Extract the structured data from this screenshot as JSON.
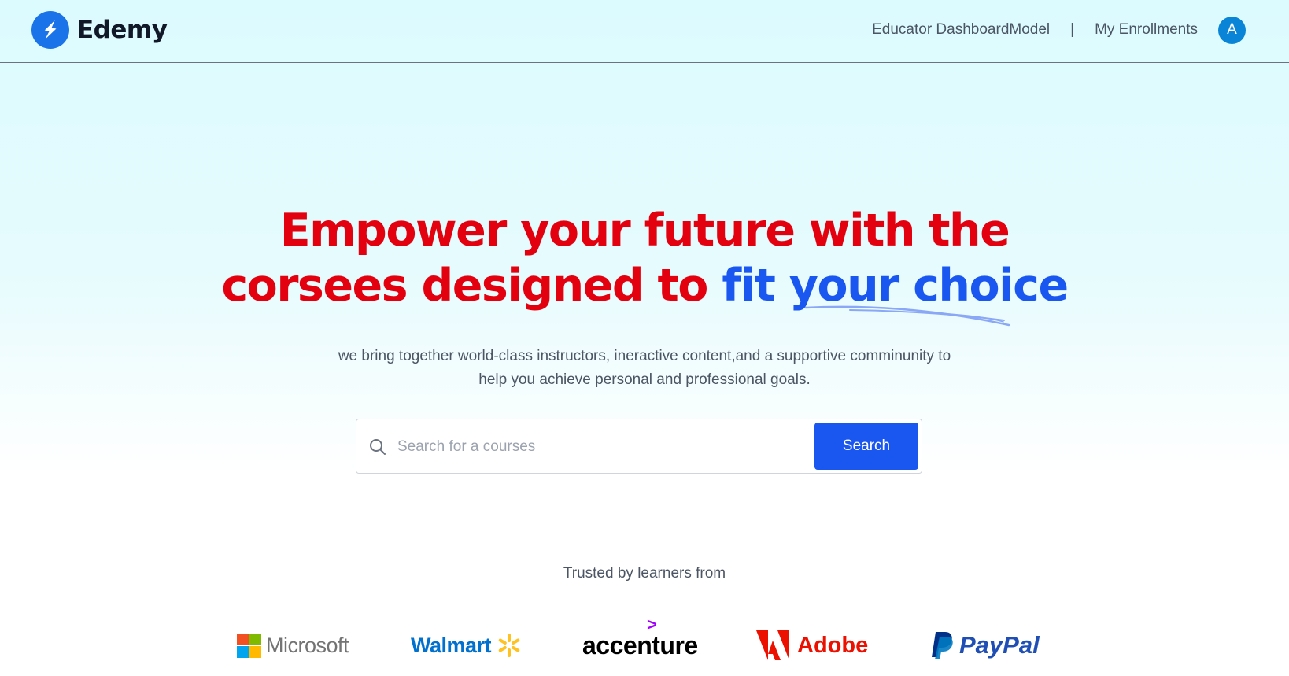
{
  "header": {
    "logo_text": "Edemy",
    "nav": {
      "educator_link": "Educator DashboardModel",
      "separator": "|",
      "enrollments_link": "My Enrollments",
      "avatar_initial": "A"
    }
  },
  "hero": {
    "headline_line1": "Empower your future with the",
    "headline_line2_red": "corsees designed to",
    "headline_line2_blue": "fit your choice",
    "subtitle_line1": "we bring together world-class instructors, ineractive content,and a supportive comminunity to",
    "subtitle_line2": "help you achieve personal and professional goals."
  },
  "search": {
    "placeholder": "Search for a courses",
    "value": "",
    "button_label": "Search"
  },
  "trusted": {
    "label": "Trusted by learners from",
    "brands": [
      "Microsoft",
      "Walmart",
      "accenture",
      "Adobe",
      "PayPal"
    ]
  },
  "colors": {
    "headline_red": "#e3000f",
    "headline_blue": "#1a56f0",
    "search_button": "#1a56f0",
    "avatar": "#0a84d6",
    "logo_mark": "#1a73e8"
  },
  "icons": {
    "logo": "lightning-bolt-icon",
    "search": "search-icon"
  }
}
